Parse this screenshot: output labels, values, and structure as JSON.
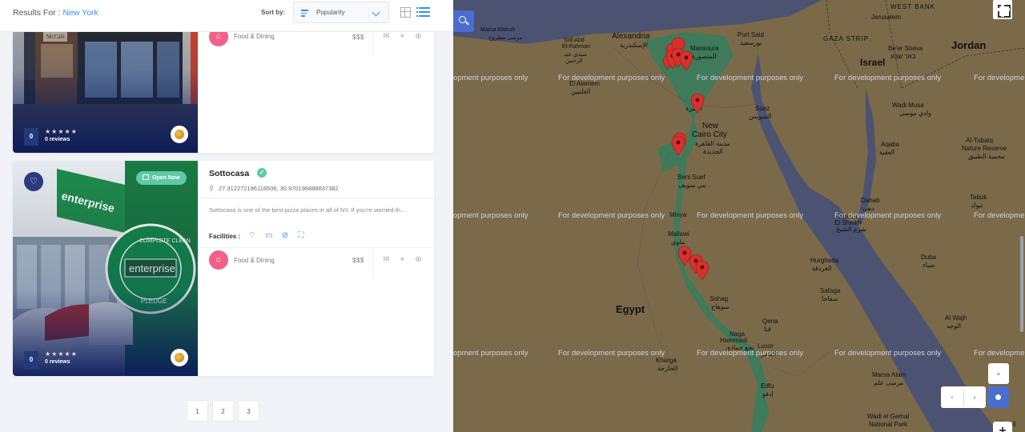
{
  "header": {
    "results_prefix": "Results For : ",
    "results_city": "New York",
    "sort_label": "Sort by:",
    "sort_value": "Popularity"
  },
  "listings": [
    {
      "rating": "0",
      "stars": "★★★★★",
      "reviews": "0 reviews",
      "category": "Food & Dining",
      "price": "$$$"
    },
    {
      "title": "Sottocasa",
      "open_label": "Open Now",
      "coordinates": "27.312272196118506, 30.970196888837382",
      "description": "Sottocasa is one of the best pizza places in all of NY. If you're worried th...",
      "facilities_label": "Facilities :",
      "rating": "0",
      "stars": "★★★★★",
      "reviews": "0 reviews",
      "category": "Food & Dining",
      "price": "$$$"
    }
  ],
  "pagination": [
    "1",
    "2",
    "3"
  ],
  "map": {
    "watermark": "For development purposes only",
    "watermark_left": "opment purposes only",
    "watermark_right": "For developme",
    "labels": {
      "jerusalem": "Jerusalem",
      "west_bank": "WEST BANK",
      "gaza": "GAZA STRIP",
      "israel": "Israel",
      "jordan": "Jordan",
      "alexandria": "Alexandria",
      "alexandria_ar": "الإسكندرية",
      "port_said": "Port Said",
      "port_said_ar": "بورسعيد",
      "mansoura": "Mansoura",
      "mansoura_ar": "المنصورة",
      "beer_sheva": "Be'er Sheva",
      "beer_sheva_ar": "באר שבע",
      "marsa_matruh": "Marsa Matruh",
      "marsa_matruh_ar": "مرسى مطروح",
      "sidi_abd": "Sidi Abd",
      "el_rahman": "El-Rahman",
      "sidi_abd_ar": "سيدي عبد",
      "el_rahman_ar": "الرحمن",
      "el_alamein": "El Alamein",
      "el_alamein_ar": "العلمين",
      "suez": "Suez",
      "suez_ar": "السويس",
      "new_cairo": "New",
      "new_cairo2": "Cairo City",
      "new_cairo_ar": "مدينة القاهرة",
      "new_cairo_ar2": "الجديدة",
      "giza_ar": "الجيزة",
      "wadi_musa": "Wadi Musa",
      "wadi_musa_ar": "وادي موسى",
      "aqaba": "Aqaba",
      "aqaba_ar": "العقبة",
      "al_tubaiq": "Al-Tubaiq",
      "nature_reserve": "Nature Reserve",
      "al_tubaiq_ar": "محمية الطبيق",
      "beni_suef": "Beni Suef",
      "beni_suef_ar": "بني سويف",
      "tabuk": "Tabuk",
      "tabuk_ar": "تبوك",
      "dahab": "Dahab",
      "dahab_ar": "دهب",
      "sharm": "Sharm",
      "el_sheikh": "El Sheikh",
      "sharm_ar": "شرم الشيخ",
      "minya": "Minya",
      "mallawi": "Mallawi",
      "mallawi_ar": "ملوي",
      "hurghada": "Hurghada",
      "hurghada_ar": "الغردقة",
      "duba": "Duba",
      "duba_ar": "ضباء",
      "safaga": "Safaga",
      "safaga_ar": "سفاجا",
      "sohag": "Sohag",
      "sohag_ar": "سوهاج",
      "egypt": "Egypt",
      "al_wajh": "Al Wajh",
      "al_wajh_ar": "الوجه",
      "qena": "Qena",
      "qena_ar": "قنا",
      "naga": "Naga",
      "hammadi": "Hammadi",
      "naga_ar": "نجع حمادي",
      "luxor": "Luxor",
      "luxor_ar": "الأقصر",
      "kharga": "Kharga",
      "kharga_ar": "الخارجة",
      "marsa_alam": "Marsa Alam",
      "marsa_alam_ar": "مرسى علم",
      "edfu": "Edfu",
      "edfu_ar": "إدفو",
      "wadi_el_gemal": "Wadi el Gemal",
      "national_park": "National Park",
      "umluj": "Umluj"
    }
  },
  "colors": {
    "accent": "#3a8fe8",
    "category": "#f2608a",
    "open_badge": "#5ec9a6",
    "rating_box": "#233a7a",
    "map_button": "#4a6ed0",
    "map_land": "#7b6a49",
    "map_sea": "#4b5272",
    "map_nile": "#3f7a5a",
    "marker": "#d8312d"
  }
}
